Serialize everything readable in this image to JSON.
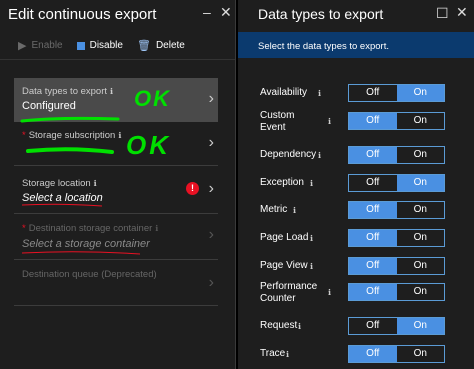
{
  "left": {
    "title": "Edit continuous export",
    "close_glyph": "✕",
    "minimize_glyph": "–",
    "toolbar": {
      "enable_label": "Enable",
      "disable_label": "Disable",
      "delete_label": "Delete"
    },
    "fields": [
      {
        "label": "Data types to export",
        "value": "Configured",
        "required": false,
        "error": false,
        "disabled": false
      },
      {
        "label": "Storage subscription",
        "value": "",
        "required": true,
        "error": false,
        "disabled": false
      },
      {
        "label": "Storage location",
        "value": "Select a location",
        "required": false,
        "error": true,
        "disabled": false
      },
      {
        "label": "Destination storage container",
        "value": "Select a storage container",
        "required": true,
        "error": false,
        "disabled": true
      },
      {
        "label": "Destination queue (Deprecated)",
        "value": "",
        "required": false,
        "error": false,
        "disabled": true
      }
    ],
    "annotations": {
      "ok1": "OK",
      "ok2": "OK"
    }
  },
  "right": {
    "title": "Data types to export",
    "banner": "Select the data types to export.",
    "off_label": "Off",
    "on_label": "On",
    "types": [
      {
        "label": "Availability",
        "state": "on"
      },
      {
        "label": "Custom Event",
        "state": "off"
      },
      {
        "label": "Dependency",
        "state": "off"
      },
      {
        "label": "Exception",
        "state": "on"
      },
      {
        "label": "Metric",
        "state": "off"
      },
      {
        "label": "Page Load",
        "state": "off"
      },
      {
        "label": "Page View",
        "state": "off"
      },
      {
        "label": "Performance Counter",
        "state": "off"
      },
      {
        "label": "Request",
        "state": "on"
      },
      {
        "label": "Trace",
        "state": "off"
      }
    ]
  },
  "colors": {
    "accent": "#4a90e2",
    "banner": "#0b3a6e",
    "error": "#e81123",
    "annotation": "#00e000"
  }
}
